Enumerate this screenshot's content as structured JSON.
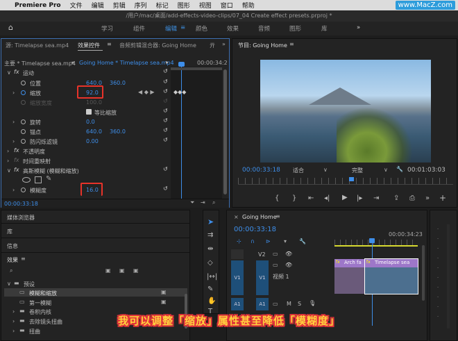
{
  "menubar": {
    "apple": "",
    "app": "Premiere Pro",
    "items": [
      "文件",
      "编辑",
      "剪辑",
      "序列",
      "标记",
      "图形",
      "视图",
      "窗口",
      "帮助"
    ]
  },
  "watermark": "www.MacZ.com",
  "title": "/用户/mac/桌面/add-effects-video-clips/07_04 Create effect presets.prproj *",
  "workspaces": [
    "学习",
    "组件",
    "编辑",
    "颜色",
    "效果",
    "音频",
    "图形",
    "库"
  ],
  "workspace_active": "编辑",
  "effect_controls": {
    "tab_source": "源: Timelapse sea.mp4",
    "tab_effects": "效果控件",
    "tab_mixer": "音频剪辑混合器: Going Home",
    "master": "主要 * Timelapse sea.mp4",
    "sequence_clip": "Going Home * Timelapse sea.mp4",
    "timecode_right": "00:00:34:2",
    "fx_motion": "运动",
    "position_label": "位置",
    "position_x": "640.0",
    "position_y": "360.0",
    "scale_label": "缩放",
    "scale_value": "92.0",
    "scale_width_label": "缩放宽度",
    "scale_width_value": "100.0",
    "uniform_scale_label": "等比缩放",
    "rotation_label": "旋转",
    "rotation_value": "0.0",
    "anchor_label": "锚点",
    "anchor_x": "640.0",
    "anchor_y": "360.0",
    "antiflicker_label": "防闪烁滤镜",
    "antiflicker_value": "0.00",
    "opacity_label": "不透明度",
    "time_remap_label": "时间重映射",
    "blur_label": "高斯模糊 (模糊和缩放)",
    "blurriness_label": "模糊度",
    "blurriness_value": "16.0",
    "timecode_bottom": "00:00:33:18"
  },
  "program": {
    "title": "节目: Going Home",
    "timecode": "00:00:33:18",
    "fit": "适合",
    "quality": "完整",
    "duration": "00:01:03:03"
  },
  "project_panels": {
    "media_browser": "媒体浏览器",
    "library": "库",
    "info": "信息",
    "effects": "效果",
    "presets": "预设",
    "preset_item_selected": "模糊和缩放",
    "preset_item_2": "第一模糊",
    "folder_3": "卷积内核",
    "folder_4": "去除镜头扭曲",
    "folder_5": "扭曲"
  },
  "timeline": {
    "title": "Going Home",
    "timecode": "00:00:33:18",
    "ruler_time": "00:00:34:23",
    "tracks": {
      "v2": "V2",
      "v1": "V1",
      "v1_name": "视频 1",
      "a1": "A1"
    },
    "clip_left": "Arch fa",
    "clip_right": "Timelapse sea",
    "fx_badge": "fx"
  },
  "subtitle": "我可以调整「缩放」属性甚至降低「模糊度」",
  "colors": {
    "accent": "#3e8ee9",
    "highlight": "#e8332a",
    "subtitle": "#ffd23e"
  }
}
